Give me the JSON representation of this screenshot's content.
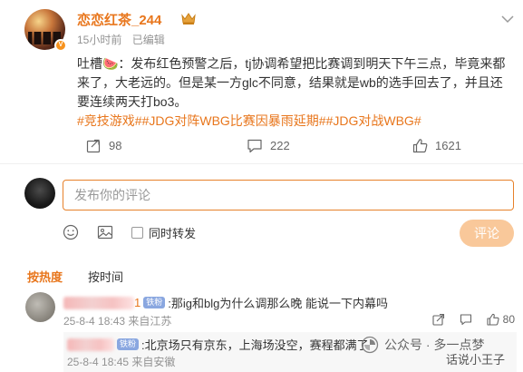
{
  "post": {
    "username": "恋恋红茶_244",
    "time": "15小时前",
    "edited": "已编辑",
    "content": "吐槽🍉：发布红色预警之后，tj协调希望把比赛调到明天下午三点，毕竟来都来了，大老远的。但是某一方glc不同意，结果就是wb的选手回去了，并且还要连续两天打bo3。",
    "topics": "#竞技游戏##JDG对阵WBG比赛因暴雨延期##JDG对战WBG#",
    "reposts": "98",
    "comments": "222",
    "likes": "1621"
  },
  "composer": {
    "placeholder": "发布你的评论",
    "repost_label": "同时转发",
    "submit_label": "评论"
  },
  "sort": {
    "hot": "按热度",
    "time": "按时间"
  },
  "comment1": {
    "name_tail": "1",
    "badge": "铁粉",
    "text": ":那ig和blg为什么调那么晚 能说一下内幕吗",
    "meta": "25-8-4 18:43 来自江苏",
    "likes": "80"
  },
  "reply1": {
    "badge": "铁粉",
    "text": ":北京场只有京东，上海场没空，赛程都满了",
    "meta": "25-8-4 18:45 来自安徽"
  },
  "watermark": {
    "brand": "公众号 · 多一点梦",
    "user": "话说小王子"
  },
  "colors": {
    "accent": "#e8761c",
    "submit_bg": "#f9c89a",
    "meta": "#939393"
  }
}
